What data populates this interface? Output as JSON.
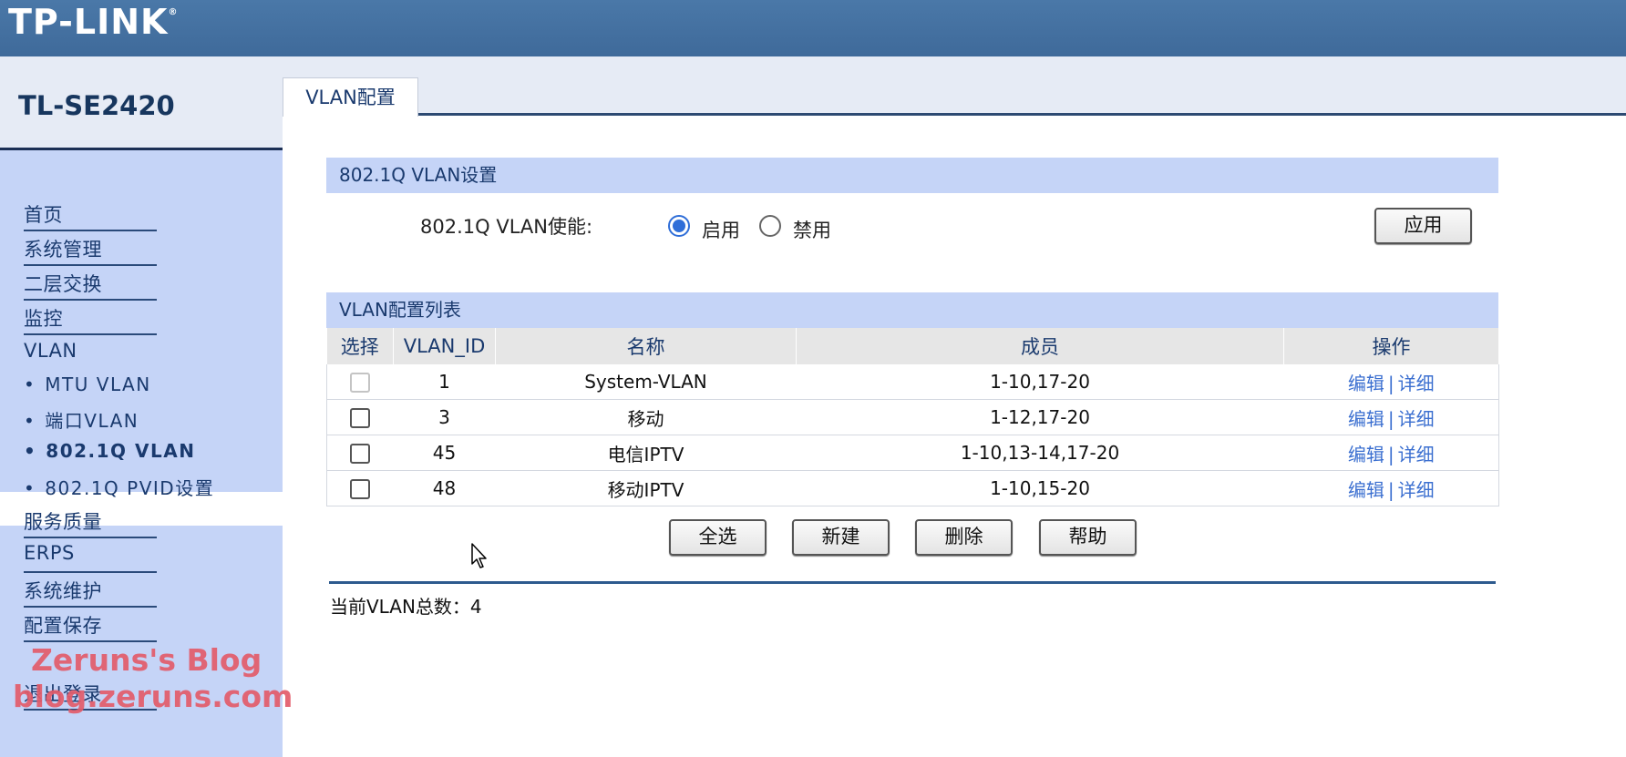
{
  "header": {
    "logo_text": "TP-LINK",
    "logo_mark": "®"
  },
  "device": {
    "model": "TL-SE2420"
  },
  "nav": {
    "items": [
      {
        "label": "首页"
      },
      {
        "label": "系统管理"
      },
      {
        "label": "二层交换"
      },
      {
        "label": "监控"
      },
      {
        "label": "VLAN"
      }
    ],
    "sub_items": [
      {
        "label": "MTU VLAN"
      },
      {
        "label": "端口VLAN"
      },
      {
        "label": "802.1Q VLAN",
        "active": true
      },
      {
        "label": "802.1Q PVID设置"
      }
    ],
    "items_after": [
      {
        "label": "服务质量"
      },
      {
        "label": "ERPS"
      },
      {
        "label": "系统维护"
      },
      {
        "label": "配置保存"
      },
      {
        "label": "退出登录"
      }
    ],
    "bullet": "•"
  },
  "tab": {
    "label": "VLAN配置"
  },
  "settings": {
    "title": "802.1Q VLAN设置",
    "enable_label": "802.1Q VLAN使能:",
    "option_enable": "启用",
    "option_disable": "禁用",
    "selected": "启用",
    "apply_button": "应用"
  },
  "list": {
    "title": "VLAN配置列表",
    "columns": [
      "选择",
      "VLAN_ID",
      "名称",
      "成员",
      "操作"
    ],
    "rows": [
      {
        "vlan_id": "1",
        "name": "System-VLAN",
        "members": "1-10,17-20",
        "selectable": false
      },
      {
        "vlan_id": "3",
        "name": "移动",
        "members": "1-12,17-20",
        "selectable": true
      },
      {
        "vlan_id": "45",
        "name": "电信IPTV",
        "members": "1-10,13-14,17-20",
        "selectable": true
      },
      {
        "vlan_id": "48",
        "name": "移动IPTV",
        "members": "1-10,15-20",
        "selectable": true
      }
    ],
    "op_edit": "编辑",
    "op_sep": "|",
    "op_detail": "详细",
    "buttons": {
      "select_all": "全选",
      "new": "新建",
      "delete": "删除",
      "help": "帮助"
    },
    "total_text": "当前VLAN总数：4"
  },
  "watermark": {
    "line1": "Zeruns's Blog",
    "line2": "blog.zeruns.com"
  },
  "colors": {
    "header": "#3f6a9a",
    "sidebar": "#c5d4f7",
    "section_head": "#c5d4f7",
    "link": "#3b6fd0",
    "radio_selected": "#2f6ed8"
  }
}
